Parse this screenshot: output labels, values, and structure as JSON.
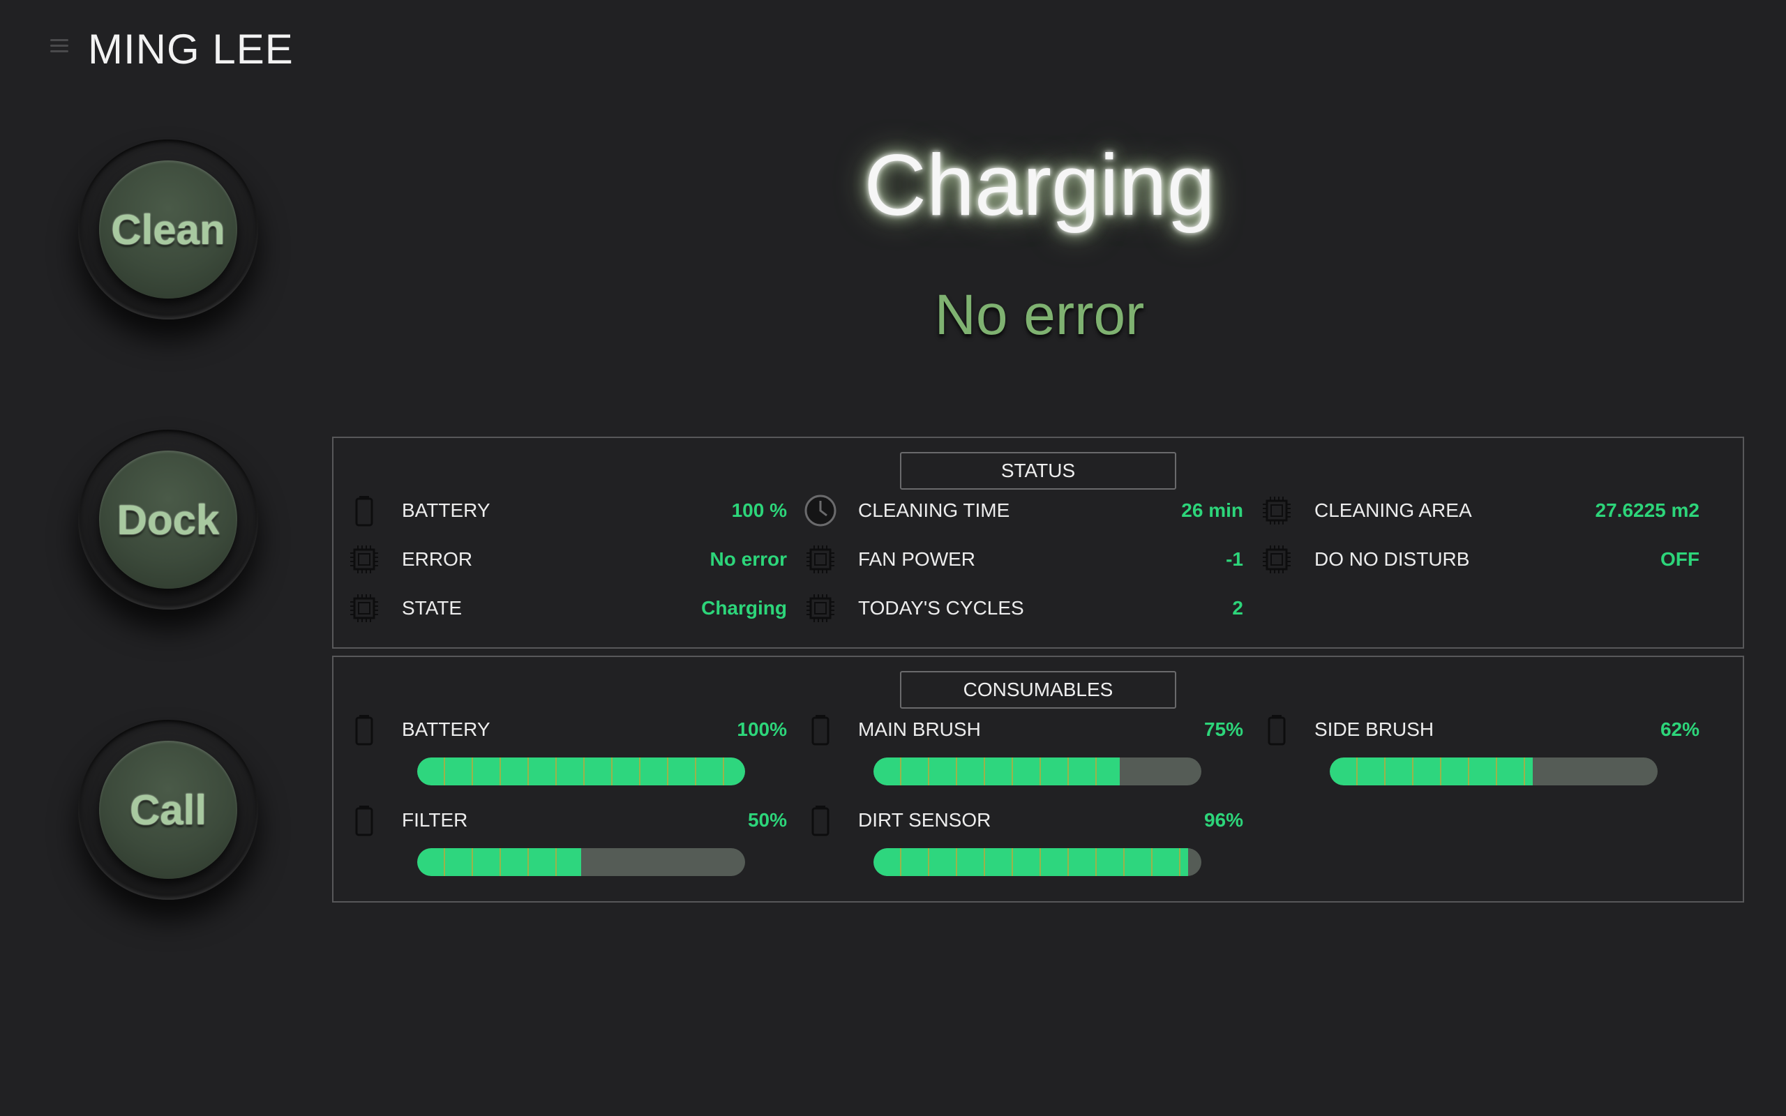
{
  "header": {
    "title": "MING LEE",
    "menu_icon": "hamburger-menu-icon"
  },
  "actions": [
    {
      "id": "clean",
      "label": "Clean"
    },
    {
      "id": "dock",
      "label": "Dock"
    },
    {
      "id": "call",
      "label": "Call"
    }
  ],
  "main": {
    "state": "Charging",
    "error": "No error"
  },
  "status": {
    "title": "STATUS",
    "items": [
      {
        "icon": "battery-icon",
        "label": "BATTERY",
        "value": "100 %"
      },
      {
        "icon": "chip-icon",
        "label": "ERROR",
        "value": "No error"
      },
      {
        "icon": "chip-icon",
        "label": "STATE",
        "value": "Charging"
      },
      {
        "icon": "clock-icon",
        "label": "CLEANING TIME",
        "value": "26 min"
      },
      {
        "icon": "chip-icon",
        "label": "FAN POWER",
        "value": "-1"
      },
      {
        "icon": "chip-icon",
        "label": "TODAY'S CYCLES",
        "value": "2"
      },
      {
        "icon": "chip-icon",
        "label": "CLEANING AREA",
        "value": "27.6225 m2"
      },
      {
        "icon": "chip-icon",
        "label": "DO NO DISTURB",
        "value": "OFF"
      }
    ]
  },
  "consumables": {
    "title": "CONSUMABLES",
    "items": [
      {
        "icon": "battery-icon",
        "label": "BATTERY",
        "value": "100%",
        "level": 1.0
      },
      {
        "icon": "battery-icon",
        "label": "FILTER",
        "value": "50%",
        "level": 0.5
      },
      {
        "icon": "battery-icon",
        "label": "MAIN BRUSH",
        "value": "75%",
        "level": 0.75
      },
      {
        "icon": "battery-icon",
        "label": "DIRT SENSOR",
        "value": "96%",
        "level": 0.96
      },
      {
        "icon": "battery-icon",
        "label": "SIDE BRUSH",
        "value": "62%",
        "level": 0.62
      }
    ]
  },
  "colors": {
    "background": "#212123",
    "accent_value": "#2dd57a",
    "error_text": "#7fb271",
    "bar_fill": "#2ed67e",
    "bar_track": "#555c56"
  }
}
